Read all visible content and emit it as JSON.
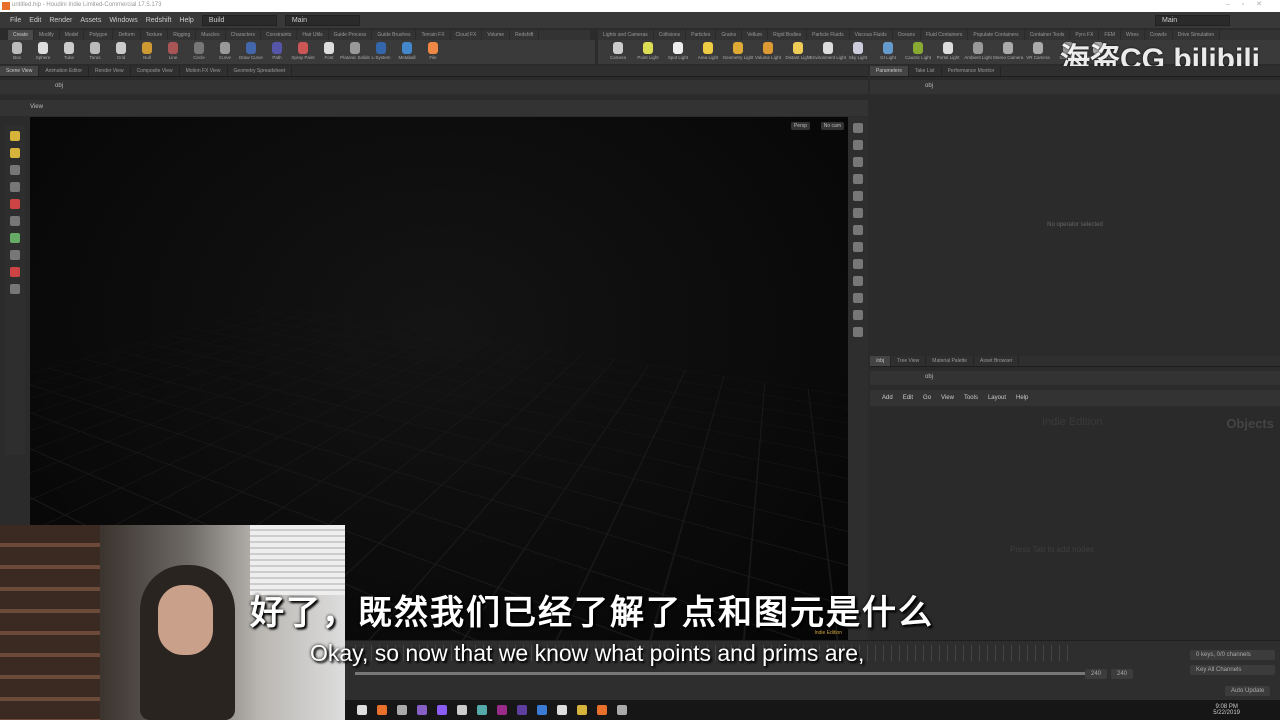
{
  "title": "untitled.hip - Houdini Indie Limited-Commercial 17.5.173",
  "menu": [
    "File",
    "Edit",
    "Render",
    "Assets",
    "Windows",
    "Redshift",
    "Help"
  ],
  "desktop": "Build",
  "desktop2": "Main",
  "desktop_right": "Main",
  "shelf_tabs_left": [
    "Create",
    "Modify",
    "Model",
    "Polygon",
    "Deform",
    "Texture",
    "Rigging",
    "Muscles",
    "Characters",
    "Constraints",
    "Hair Utils",
    "Guide Process",
    "Guide Brushes",
    "Terrain FX",
    "Cloud FX",
    "Volume",
    "Redshift"
  ],
  "shelf_tools_left": [
    "Box",
    "Sphere",
    "Tube",
    "Torus",
    "Grid",
    "Null",
    "Line",
    "Circle",
    "Curve",
    "Draw Curve",
    "Path",
    "Spray Paint",
    "Font",
    "Platonic Solids",
    "L-System",
    "Metaball",
    "File"
  ],
  "shelf_tabs_right": [
    "Lights and Cameras",
    "Collisions",
    "Particles",
    "Grains",
    "Vellum",
    "Rigid Bodies",
    "Particle Fluids",
    "Viscous Fluids",
    "Oceans",
    "Fluid Containers",
    "Populate Containers",
    "Container Tools",
    "Pyro FX",
    "FEM",
    "Wires",
    "Crowds",
    "Drive Simulation"
  ],
  "shelf_tools_right": [
    "Camera",
    "Point Light",
    "Spot Light",
    "Area Light",
    "Geometry Light",
    "Volume Light",
    "Distant Light",
    "Environment Light",
    "Sky Light",
    "GI Light",
    "Caustic Light",
    "Portal Light",
    "Ambient Light",
    "Stereo Camera",
    "VR Camera",
    "Switcher",
    "Gamepad Camera"
  ],
  "pane_tabs_left": [
    "Scene View",
    "Animation Editor",
    "Render View",
    "Composite View",
    "Motion FX View",
    "Geometry Spreadsheet"
  ],
  "pane_tabs_right": [
    "Parameters",
    "Take List",
    "Performance Monitor"
  ],
  "net_tabs": [
    "/obj",
    "Tree View",
    "Material Palette",
    "Asset Browser"
  ],
  "path": "obj",
  "view_label": "View",
  "persp": "Persp",
  "cam": "No cam",
  "no_selection": "No operator selected",
  "net_menu": [
    "Add",
    "Edit",
    "Go",
    "View",
    "Tools",
    "Layout",
    "Help"
  ],
  "net_context": "Objects",
  "net_edition": "Indie Edition",
  "net_hint": "Press Tab to add nodes",
  "indie": "Indie Edition",
  "keys": "0 keys, 0/0 channels",
  "key_all": "Key All Channels",
  "frame_end": "240",
  "frame_end2": "240",
  "auto_update": "Auto Update",
  "clock_time": "9:08 PM",
  "clock_date": "5/22/2019",
  "subtitle_cn": "好了，既然我们已经了解了点和图元是什么",
  "subtitle_en": "Okay, so now that we know what points and prims are,",
  "watermark": "海盗CG bilibili"
}
